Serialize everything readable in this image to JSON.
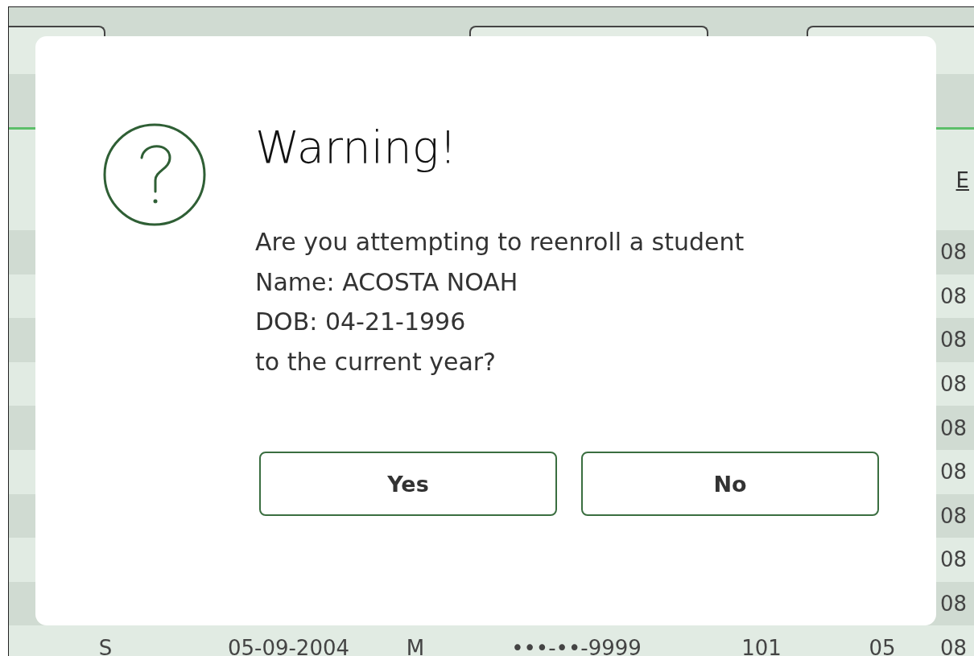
{
  "background_table": {
    "header_link": "E",
    "rows": [
      {
        "cells": [
          "08"
        ]
      },
      {
        "cells": [
          "08"
        ]
      },
      {
        "cells": [
          "08"
        ]
      },
      {
        "cells": [
          "08"
        ]
      },
      {
        "cells": [
          "08"
        ]
      },
      {
        "cells": [
          "08"
        ]
      },
      {
        "cells": [
          "08"
        ]
      },
      {
        "cells": [
          "08"
        ]
      },
      {
        "cells": [
          "08"
        ]
      },
      {
        "cells": [
          "S",
          "05-09-2004",
          "M",
          "•••-••-9999",
          "101",
          "05",
          "08"
        ]
      }
    ]
  },
  "dialog": {
    "title": "Warning!",
    "message_lines": [
      "Are you attempting to reenroll a student",
      "Name: ACOSTA NOAH",
      "DOB: 04-21-1996",
      "to the current year?"
    ],
    "buttons": [
      {
        "label": "Yes"
      },
      {
        "label": "No"
      }
    ]
  }
}
